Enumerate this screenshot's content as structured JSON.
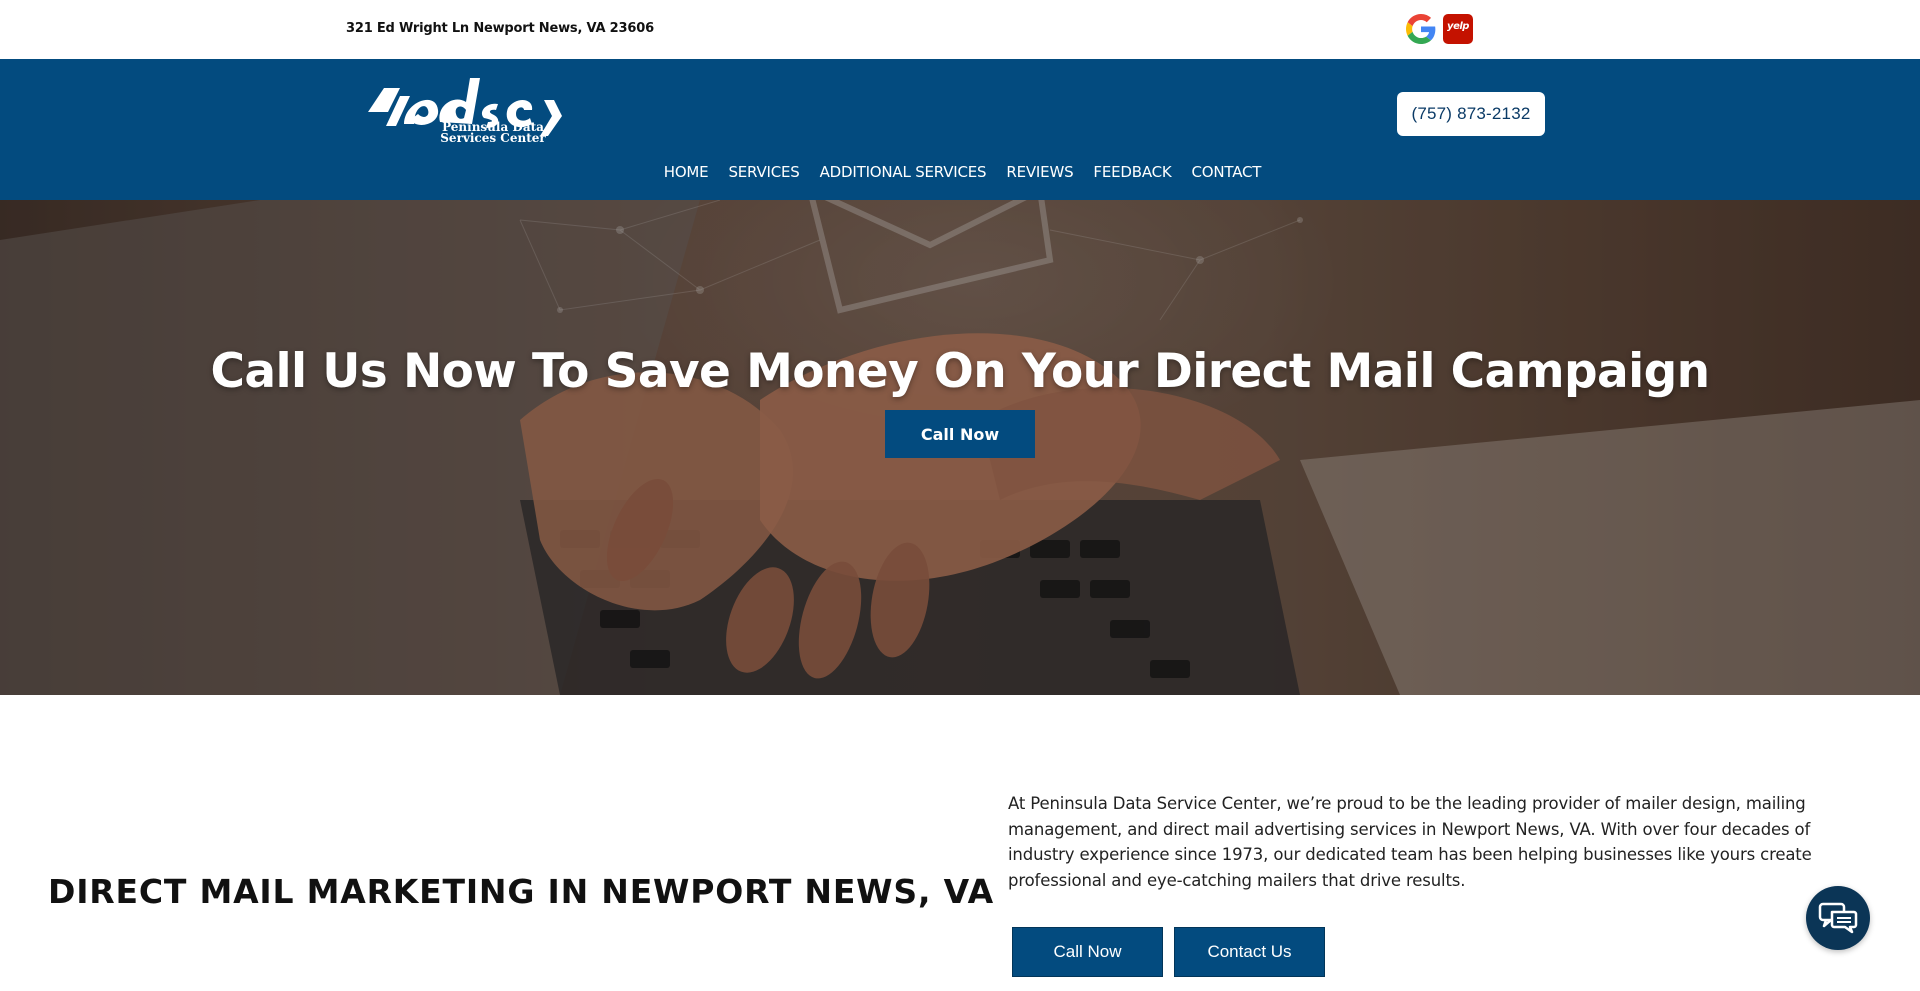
{
  "topbar": {
    "address": "321 Ed Wright Ln Newport News, VA 23606",
    "social": [
      {
        "name": "google-icon",
        "label": "Google"
      },
      {
        "name": "yelp-icon",
        "label": "yelp"
      }
    ]
  },
  "header": {
    "logo_text": "Peninsula Data Services Center",
    "logo_line1": "Peninsula Data",
    "logo_line2": "Services Center",
    "phone": "(757) 873-2132",
    "nav": [
      "HOME",
      "SERVICES",
      "ADDITIONAL SERVICES",
      "REVIEWS",
      "FEEDBACK",
      "CONTACT"
    ]
  },
  "hero": {
    "title": "Call Us Now To Save Money On Your Direct Mail Campaign",
    "button": "Call Now"
  },
  "content": {
    "heading": "DIRECT MAIL MARKETING IN NEWPORT NEWS, VA",
    "intro": "At Peninsula Data Service Center, we’re proud to be the leading provider of mailer design, mailing management, and direct mail advertising services in Newport News, VA. With over four decades of industry experience since 1973, our dedicated team has been helping businesses like yours create professional and eye-catching mailers that drive results.",
    "call_button": "Call Now",
    "contact_button": "Contact Us"
  },
  "colors": {
    "brand_blue": "#034b7f",
    "yelp_red": "#c41200",
    "chat_navy": "#0b3556"
  }
}
